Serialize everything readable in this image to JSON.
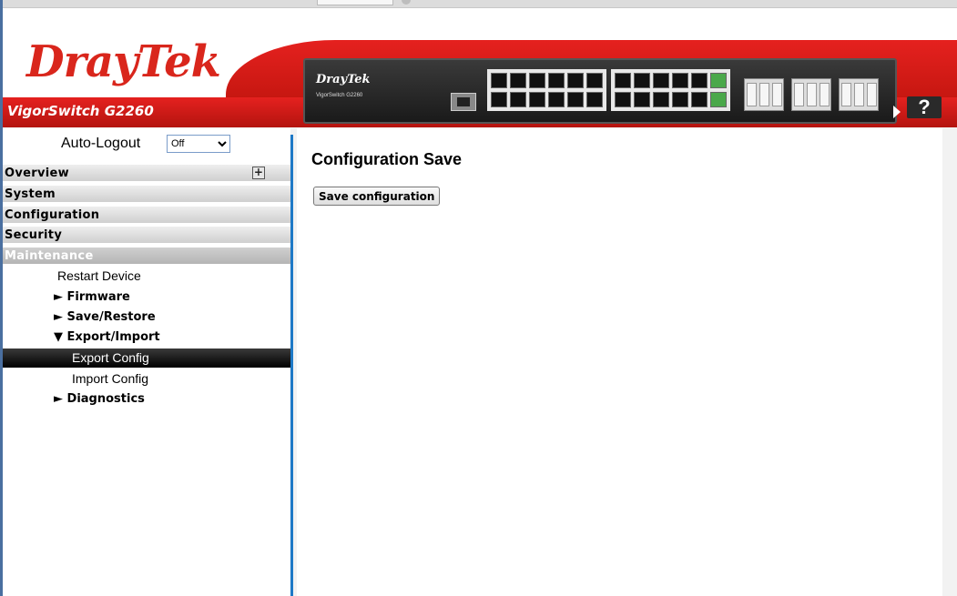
{
  "header": {
    "brand": "DrayTek",
    "model": "VigorSwitch G2260",
    "panel_brand": "DrayTek",
    "panel_model": "VigorSwitch G2260",
    "help_label": "?"
  },
  "sidebar": {
    "autologout_label": "Auto-Logout",
    "autologout_value": "Off",
    "sections": {
      "overview": "Overview",
      "system": "System",
      "configuration": "Configuration",
      "security": "Security",
      "maintenance": "Maintenance"
    },
    "items": {
      "restart": "Restart Device",
      "firmware": "► Firmware",
      "save_restore": "► Save/Restore",
      "export_import": "▼ Export/Import",
      "export_config": "Export Config",
      "import_config": "Import Config",
      "diagnostics": "► Diagnostics"
    }
  },
  "main": {
    "title": "Configuration Save",
    "save_button": "Save configuration"
  },
  "colors": {
    "brand_red": "#d9261c",
    "divider_blue": "#1e79c6",
    "selected_bg": "#000000"
  }
}
